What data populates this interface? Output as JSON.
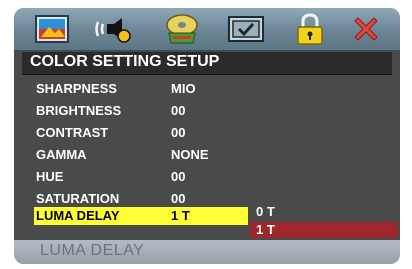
{
  "menu": {
    "tabs": [
      {
        "name": "picture-icon"
      },
      {
        "name": "audio-icon"
      },
      {
        "name": "video-disc-icon"
      },
      {
        "name": "preferences-icon"
      },
      {
        "name": "lock-icon"
      },
      {
        "name": "close-icon"
      }
    ]
  },
  "section_title": "COLOR SETTING SETUP",
  "settings": [
    {
      "label": "SHARPNESS",
      "value": "MIO"
    },
    {
      "label": "BRIGHTNESS",
      "value": "00"
    },
    {
      "label": "CONTRAST",
      "value": "00"
    },
    {
      "label": "GAMMA",
      "value": "NONE"
    },
    {
      "label": "HUE",
      "value": "00"
    },
    {
      "label": "SATURATION",
      "value": "00"
    },
    {
      "label": "LUMA DELAY",
      "value": "1 T"
    }
  ],
  "options": [
    "0 T",
    "1 T"
  ],
  "selected_option": "1 T",
  "status_text": "LUMA DELAY",
  "colors": {
    "highlight": "#ffff33",
    "selected_option_bg": "#a0282c",
    "panel_bg": "#4a4a4a"
  }
}
